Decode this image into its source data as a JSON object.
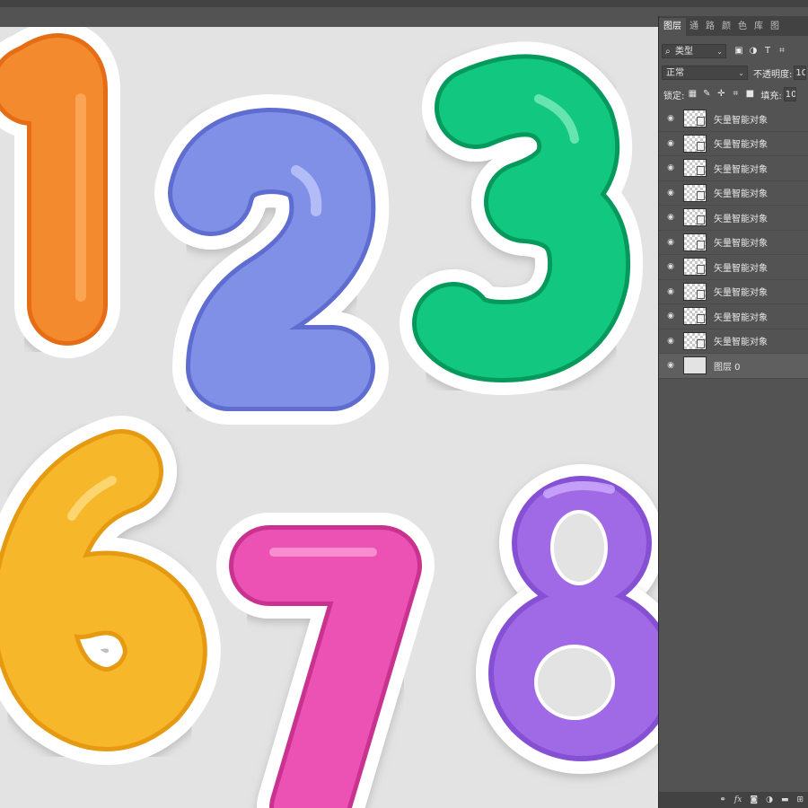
{
  "layers_panel": {
    "tabs": [
      "图层",
      "通",
      "路",
      "颜",
      "色",
      "库",
      "图"
    ],
    "filter": {
      "value": "类型"
    },
    "blend_mode": {
      "value": "正常"
    },
    "opacity": {
      "label": "不透明度:",
      "value": "10"
    },
    "lock": {
      "label": "锁定:"
    },
    "fill": {
      "label": "填充:",
      "value": "10"
    },
    "layers": [
      {
        "name": "矢量智能对象"
      },
      {
        "name": "矢量智能对象"
      },
      {
        "name": "矢量智能对象"
      },
      {
        "name": "矢量智能对象"
      },
      {
        "name": "矢量智能对象"
      },
      {
        "name": "矢量智能对象"
      },
      {
        "name": "矢量智能对象"
      },
      {
        "name": "矢量智能对象"
      },
      {
        "name": "矢量智能对象"
      },
      {
        "name": "矢量智能对象"
      },
      {
        "name": "图层 0"
      }
    ],
    "footer_icons": [
      "link-icon",
      "fx-icon",
      "mask-icon",
      "adjustment-icon",
      "folder-icon",
      "new-layer-icon"
    ]
  },
  "canvas": {
    "digits": [
      {
        "glyph": "1",
        "color": "#f38a2e"
      },
      {
        "glyph": "2",
        "color": "#8090e6"
      },
      {
        "glyph": "3",
        "color": "#12c77f"
      },
      {
        "glyph": "6",
        "color": "#f6b72b"
      },
      {
        "glyph": "7",
        "color": "#ec52b4"
      },
      {
        "glyph": "8",
        "color": "#a06ae6"
      }
    ]
  }
}
